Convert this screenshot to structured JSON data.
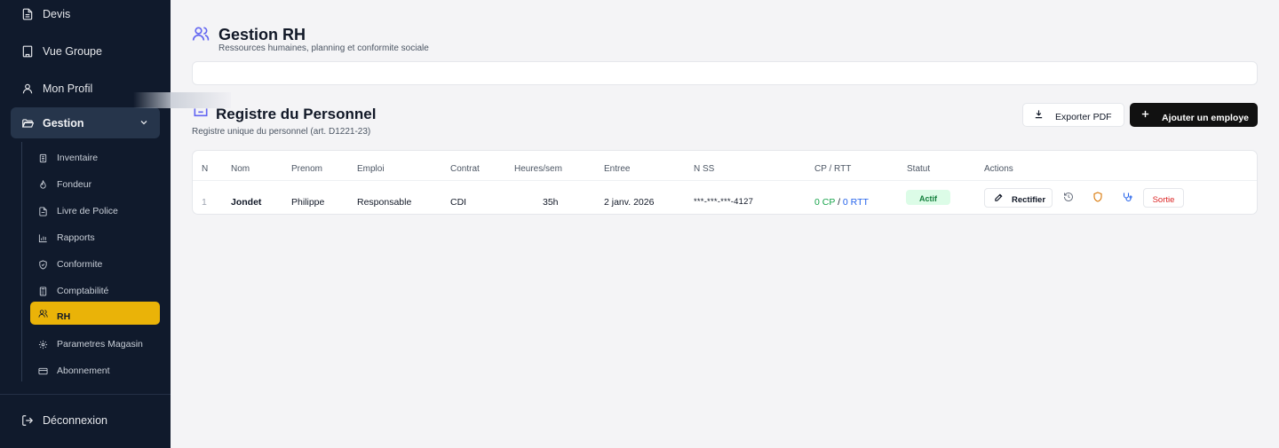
{
  "sidebar": {
    "top_items": [
      {
        "label": "Devis",
        "icon": "file-text-icon"
      },
      {
        "label": "Vue Groupe",
        "icon": "building-icon"
      },
      {
        "label": "Mon Profil",
        "icon": "user-icon"
      }
    ],
    "gestion": {
      "label": "Gestion",
      "icon": "folder-open-icon",
      "expanded": true
    },
    "sub_items": [
      {
        "label": "Inventaire",
        "icon": "clipboard-icon"
      },
      {
        "label": "Fondeur",
        "icon": "flame-icon"
      },
      {
        "label": "Livre de Police",
        "icon": "file-icon"
      },
      {
        "label": "Rapports",
        "icon": "bar-chart-icon"
      },
      {
        "label": "Conformite",
        "icon": "shield-icon"
      },
      {
        "label": "Comptabilité",
        "icon": "calculator-icon"
      },
      {
        "label": "RH",
        "icon": "users-icon",
        "active": true
      },
      {
        "label": "Parametres Magasin",
        "icon": "gear-icon"
      },
      {
        "label": "Abonnement",
        "icon": "credit-card-icon"
      }
    ],
    "logout_label": "Déconnexion"
  },
  "header": {
    "title": "Gestion RH",
    "subtitle": "Ressources humaines, planning et conformite sociale"
  },
  "registry": {
    "title": "Registre du Personnel",
    "subtitle": "Registre unique du personnel (art. D1221-23)",
    "export_label": "Exporter PDF",
    "add_label": "Ajouter un employe"
  },
  "table": {
    "columns": [
      "N",
      "Nom",
      "Prenom",
      "Emploi",
      "Contrat",
      "Heures/sem",
      "Entree",
      "N SS",
      "CP / RTT",
      "Statut",
      "Actions"
    ],
    "rows": [
      {
        "n": "1",
        "nom": "Jondet",
        "prenom": "Philippe",
        "emploi": "Responsable",
        "contrat": "CDI",
        "heures": "35h",
        "entree": "2 janv. 2026",
        "nss": "***-***-***-4127",
        "cp": "0 CP",
        "sep": "/",
        "rtt": "0 RTT",
        "statut": "Actif",
        "rectify_label": "Rectifier",
        "exit_label": "Sortie"
      }
    ]
  },
  "colors": {
    "sidebar_bg": "#101a2c",
    "accent": "#eab308",
    "status_green": "#15803d",
    "rtt_blue": "#2563eb",
    "danger": "#dc2626"
  }
}
